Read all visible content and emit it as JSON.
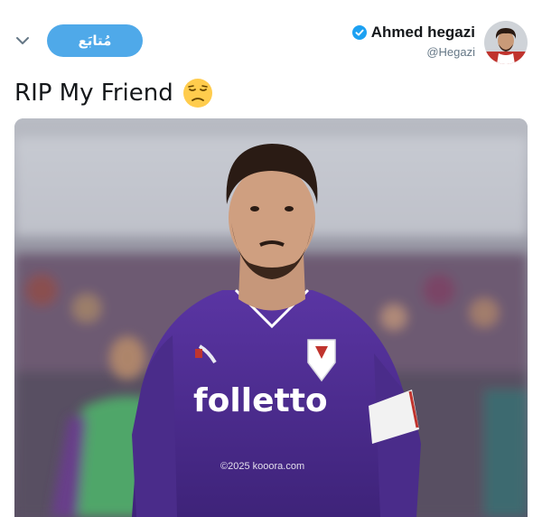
{
  "tweet": {
    "follow_label": "مُتابَع",
    "display_name": "Ahmed hegazi",
    "handle": "@Hegazi",
    "text": "RIP My Friend",
    "emoji": "disappointed-face-emoji"
  },
  "media": {
    "jersey_sponsor": "folletto",
    "watermark": "©2025 kooora.com"
  },
  "icons": {
    "menu": "chevron-down-icon",
    "verified": "verified-badge-icon"
  },
  "colors": {
    "follow_button": "#4fa9e9",
    "verified_badge": "#1da1f2",
    "jersey_purple": "#4b2a8c"
  }
}
